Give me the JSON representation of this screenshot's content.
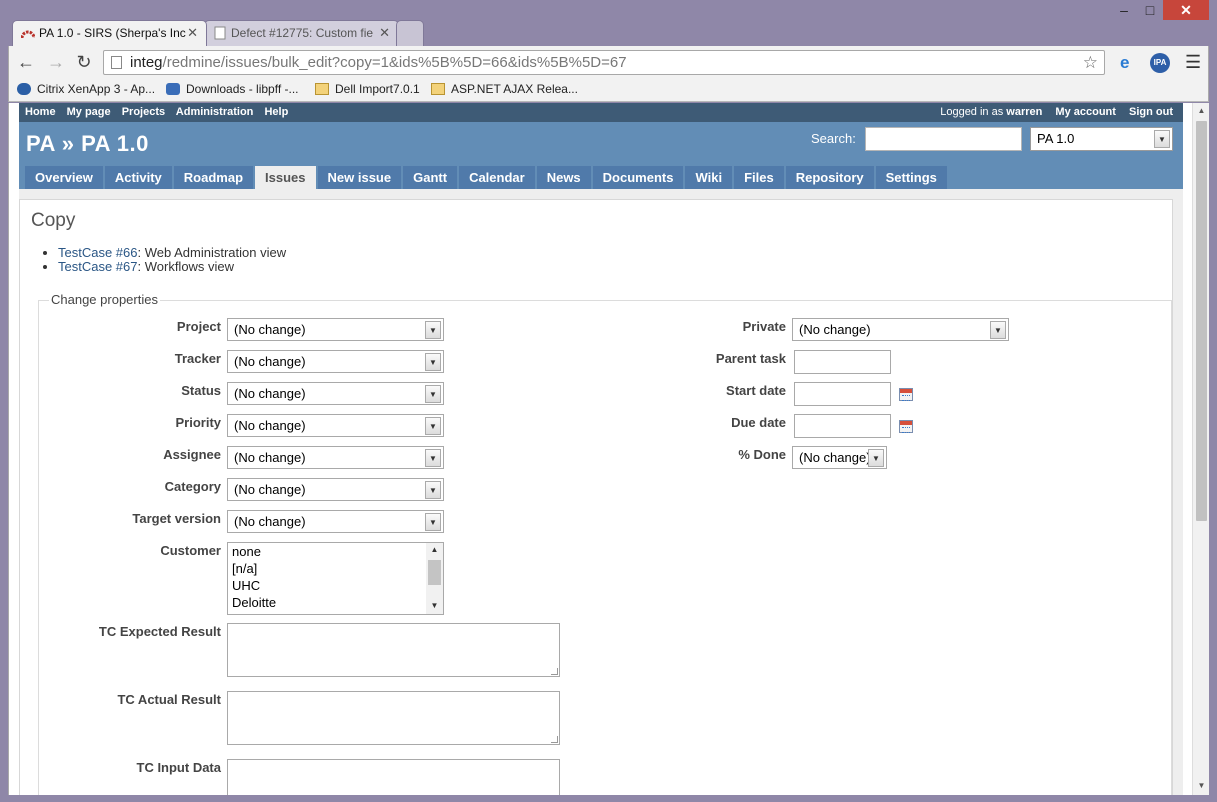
{
  "browser": {
    "window_controls": [
      "–",
      "□",
      "✕"
    ],
    "tabs": [
      {
        "title": "PA 1.0 - SIRS (Sherpa's Inc",
        "active": true
      },
      {
        "title": "Defect #12775: Custom fie",
        "active": false
      }
    ],
    "close_glyph": "✕",
    "url_host": "integ",
    "url_path": "/redmine/issues/bulk_edit?copy=1&ids%5B%5D=66&ids%5B%5D=67",
    "bookmarks": [
      {
        "label": "Citrix XenApp 3 - Ap...",
        "icon": "citrix-icon"
      },
      {
        "label": "Downloads - libpff -...",
        "icon": "download-icon"
      },
      {
        "label": "Dell Import7.0.1",
        "icon": "folder-icon"
      },
      {
        "label": "ASP.NET AJAX Relea...",
        "icon": "folder-icon"
      }
    ],
    "ext_ipa_label": "IPA"
  },
  "topmenu": {
    "home": "Home",
    "my_page": "My page",
    "projects": "Projects",
    "administration": "Administration",
    "help": "Help",
    "logged_in_as": "Logged in as",
    "user": "warren",
    "my_account": "My account",
    "sign_out": "Sign out"
  },
  "header": {
    "title": "PA » PA 1.0",
    "search_label": "Search:",
    "search_value": "",
    "project_jump": "PA 1.0"
  },
  "main_tabs": [
    "Overview",
    "Activity",
    "Roadmap",
    "Issues",
    "New issue",
    "Gantt",
    "Calendar",
    "News",
    "Documents",
    "Wiki",
    "Files",
    "Repository",
    "Settings"
  ],
  "selected_tab": "Issues",
  "content": {
    "heading": "Copy",
    "issues": [
      {
        "link": "TestCase #66",
        "subject": ": Web Administration view"
      },
      {
        "link": "TestCase #67",
        "subject": ": Workflows view"
      }
    ],
    "fieldset_legend": "Change properties",
    "left_fields": [
      {
        "label": "Project",
        "value": "(No change)"
      },
      {
        "label": "Tracker",
        "value": "(No change)"
      },
      {
        "label": "Status",
        "value": "(No change)"
      },
      {
        "label": "Priority",
        "value": "(No change)"
      },
      {
        "label": "Assignee",
        "value": "(No change)"
      },
      {
        "label": "Category",
        "value": "(No change)"
      },
      {
        "label": "Target version",
        "value": "(No change)"
      }
    ],
    "customer": {
      "label": "Customer",
      "options": [
        "none",
        "[n/a]",
        "UHC",
        "Deloitte"
      ]
    },
    "text_areas": [
      {
        "label": "TC Expected Result",
        "value": ""
      },
      {
        "label": "TC Actual Result",
        "value": ""
      },
      {
        "label": "TC Input Data",
        "value": ""
      }
    ],
    "right_fields": {
      "private": {
        "label": "Private",
        "value": "(No change)"
      },
      "parent_task": {
        "label": "Parent task",
        "value": ""
      },
      "start_date": {
        "label": "Start date",
        "value": ""
      },
      "due_date": {
        "label": "Due date",
        "value": ""
      },
      "done": {
        "label": "% Done",
        "value": "(No change)"
      }
    }
  }
}
